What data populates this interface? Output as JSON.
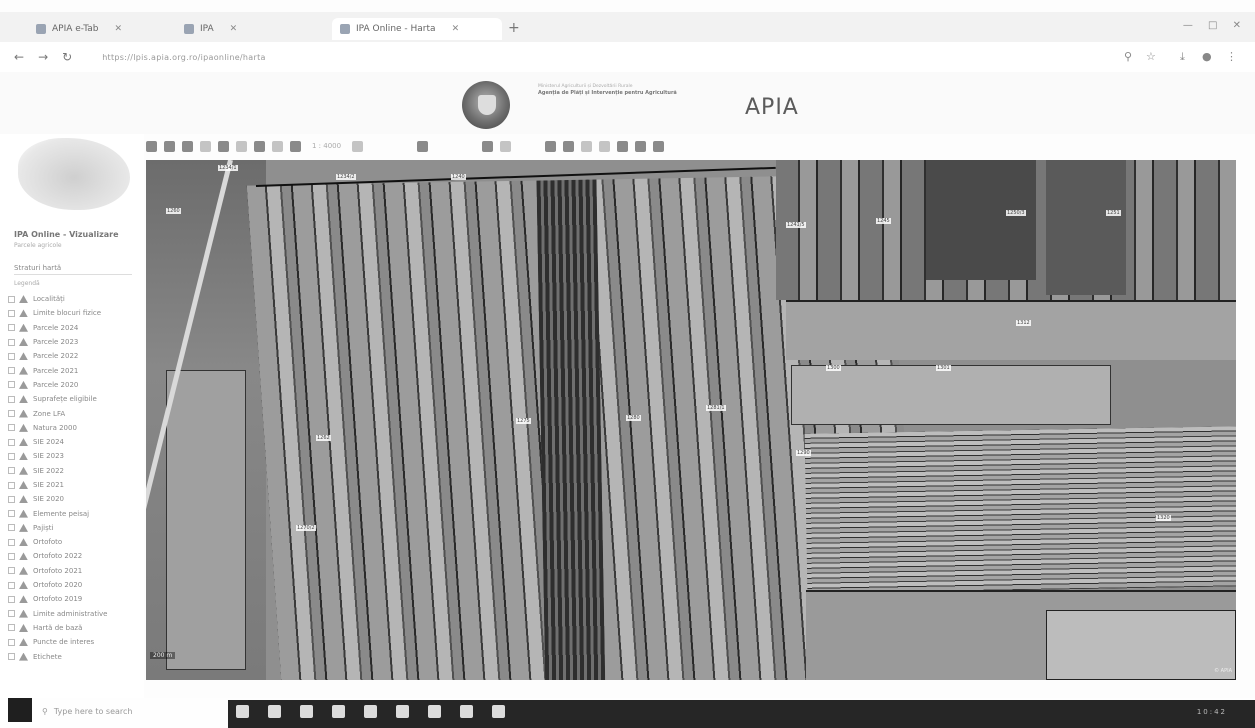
{
  "browser": {
    "tabs": [
      {
        "label": "APIA e-Tab",
        "active": false
      },
      {
        "label": "IPA",
        "active": false
      },
      {
        "label": "IPA Online - Harta",
        "active": true
      }
    ],
    "url": "https://lpis.apia.org.ro/ipaonline/harta",
    "new_tab": "+",
    "window_controls": "— □ ✕"
  },
  "header": {
    "ministry_line1": "Ministerul Agriculturii și Dezvoltării Rurale",
    "ministry_line2": "Agenția de Plăți și Intervenție pentru Agricultură",
    "logo": "APIA"
  },
  "sidebar": {
    "title": "IPA Online - Vizualizare",
    "subtitle": "Parcele agricole",
    "section": "Straturi hartă",
    "section_sub": "Legendă",
    "layers": [
      "Localități",
      "Limite blocuri fizice",
      "Parcele 2024",
      "Parcele 2023",
      "Parcele 2022",
      "Parcele 2021",
      "Parcele 2020",
      "Suprafețe eligibile",
      "Zone LFA",
      "Natura 2000",
      "SIE 2024",
      "SIE 2023",
      "SIE 2022",
      "SIE 2021",
      "SIE 2020",
      "Elemente peisaj",
      "Pajiști",
      "Ortofoto",
      "Ortofoto 2022",
      "Ortofoto 2021",
      "Ortofoto 2020",
      "Ortofoto 2019",
      "Limite administrative",
      "Hartă de bază",
      "Puncte de interes",
      "Etichete"
    ]
  },
  "toolbar": {
    "scale": "1 : 4000"
  },
  "map": {
    "scale_bar": "200 m",
    "attribution": "© APIA",
    "labels": [
      "1234/1",
      "1234/2",
      "1240",
      "1241/5",
      "1245",
      "1250/3",
      "1251",
      "1260",
      "1262",
      "1270/2",
      "1275",
      "1280",
      "1281/1",
      "1290",
      "1300",
      "1301",
      "1312",
      "1320"
    ]
  },
  "taskbar": {
    "search_placeholder": "Type here to search",
    "time": "10:42"
  }
}
